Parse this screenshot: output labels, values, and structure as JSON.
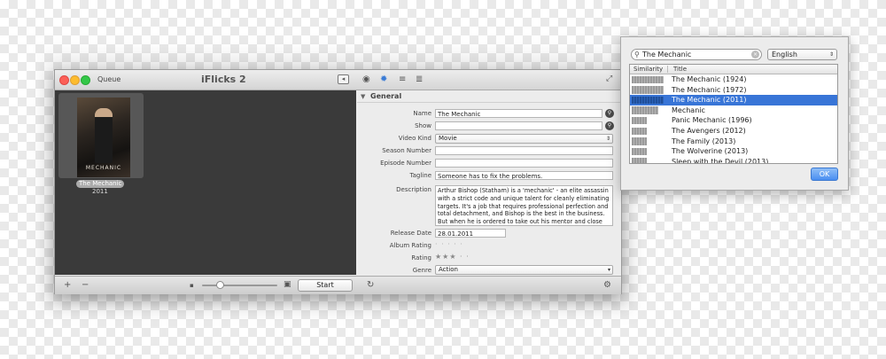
{
  "app": {
    "queue_label": "Queue",
    "title": "iFlicks 2"
  },
  "queue": {
    "item_title": "The Mechanic",
    "item_year": "2011",
    "poster_text": "MECHANIC"
  },
  "general": {
    "header": "General",
    "fields": {
      "name": {
        "label": "Name",
        "value": "The Mechanic"
      },
      "show": {
        "label": "Show",
        "value": ""
      },
      "video_kind": {
        "label": "Video Kind",
        "value": "Movie"
      },
      "season_number": {
        "label": "Season Number",
        "value": ""
      },
      "episode_number": {
        "label": "Episode Number",
        "value": ""
      },
      "tagline": {
        "label": "Tagline",
        "value": "Someone has to fix the problems."
      },
      "description": {
        "label": "Description",
        "value": "Arthur Bishop (Statham) is a 'mechanic' - an elite assassin with a strict code and unique talent for cleanly eliminating targets. It's a job that requires professional perfection and total detachment, and Bishop is the best in the business. But when he is ordered to take out his mentor and close"
      },
      "release_date": {
        "label": "Release Date",
        "value": "28.01.2011"
      },
      "album_rating": {
        "label": "Album Rating",
        "value": "· · · · ·"
      },
      "rating": {
        "label": "Rating",
        "value": "★★★ · ·",
        "stars": 3
      },
      "genre": {
        "label": "Genre",
        "value": "Action"
      }
    }
  },
  "bottom": {
    "start_label": "Start",
    "add_icon": "plus-icon",
    "remove_icon": "minus-icon"
  },
  "search_popup": {
    "query": "The Mechanic",
    "language": "English",
    "columns": {
      "similarity": "Similarity",
      "title": "Title"
    },
    "results": [
      {
        "title": "The Mechanic (1924)",
        "similarity": 0.95,
        "selected": false
      },
      {
        "title": "The Mechanic (1972)",
        "similarity": 0.95,
        "selected": false
      },
      {
        "title": "The Mechanic (2011)",
        "similarity": 0.95,
        "selected": true
      },
      {
        "title": "Mechanic",
        "similarity": 0.8,
        "selected": false
      },
      {
        "title": "Panic Mechanic (1996)",
        "similarity": 0.45,
        "selected": false
      },
      {
        "title": "The Avengers (2012)",
        "similarity": 0.45,
        "selected": false
      },
      {
        "title": "The Family (2013)",
        "similarity": 0.45,
        "selected": false
      },
      {
        "title": "The Wolverine (2013)",
        "similarity": 0.45,
        "selected": false
      },
      {
        "title": "Sleep with the Devil (2013)",
        "similarity": 0.45,
        "selected": false
      }
    ],
    "ok_label": "OK"
  }
}
